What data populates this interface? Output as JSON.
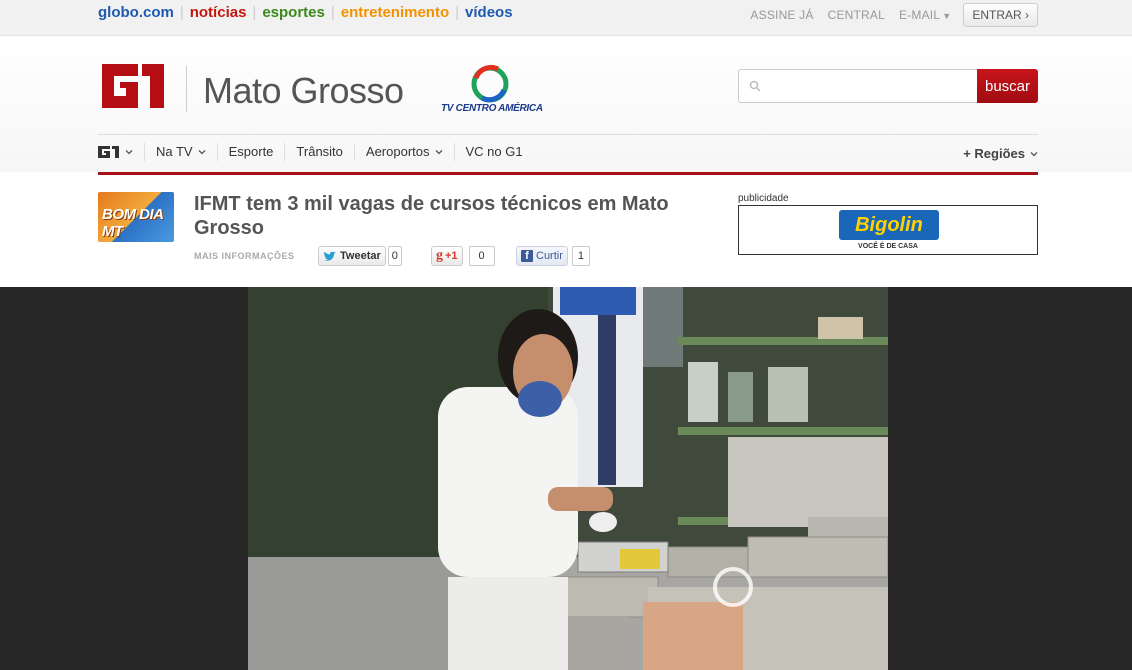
{
  "topnav": {
    "site": "globo.com",
    "links": [
      {
        "label": "notícias",
        "color": "#c4170c"
      },
      {
        "label": "esportes",
        "color": "#3a8a1c"
      },
      {
        "label": "entretenimento",
        "color": "#f39200"
      },
      {
        "label": "vídeos",
        "color": "#1d5ab0"
      }
    ],
    "site_color": "#1d5ab0",
    "assine": "ASSINE JÁ",
    "central": "CENTRAL",
    "email": "E-MAIL",
    "entrar": "ENTRAR ›"
  },
  "header": {
    "logo": "G1",
    "region": "Mato Grosso",
    "affiliate": "TV CENTRO AMÉRICA",
    "search_placeholder": "",
    "search_button": "buscar"
  },
  "menu": {
    "items": [
      "Na TV",
      "Esporte",
      "Trânsito",
      "Aeroportos",
      "VC no G1"
    ],
    "regioes": "+ Regiões"
  },
  "article": {
    "thumb_label": "BOM DIA MT",
    "title": "IFMT tem 3 mil vagas de cursos técnicos em Mato Grosso",
    "mais_info": "MAIS INFORMAÇÕES",
    "tweet_label": "Tweetar",
    "tweet_count": "0",
    "gplus_label": "+1",
    "gplus_count": "0",
    "fb_label": "Curtir",
    "fb_count": "1"
  },
  "ad": {
    "label": "publicidade",
    "brand": "Bigolin",
    "tagline": "VOCÊ É DE CASA"
  },
  "colors": {
    "accent_red": "#a80f14",
    "video_bg": "#262626"
  }
}
